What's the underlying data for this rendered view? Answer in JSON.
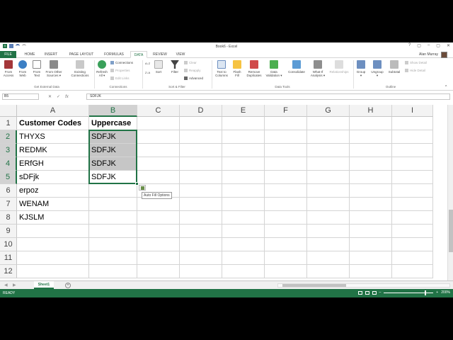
{
  "window": {
    "title": "Book6 - Excel"
  },
  "window_controls": [
    "?",
    "▢",
    "–",
    "▢",
    "✕"
  ],
  "tabs": [
    "FILE",
    "HOME",
    "INSERT",
    "PAGE LAYOUT",
    "FORMULAS",
    "DATA",
    "REVIEW",
    "VIEW"
  ],
  "user": {
    "name": "Alan Murray"
  },
  "ribbon": {
    "get_external": {
      "buttons": [
        {
          "label": "From\nAccess",
          "icon": "access-icon"
        },
        {
          "label": "From\nWeb",
          "icon": "web-icon"
        },
        {
          "label": "From\nText",
          "icon": "text-file-icon"
        },
        {
          "label": "From Other\nSources ▾",
          "icon": "other-sources-icon"
        },
        {
          "label": "Existing\nConnections",
          "icon": "existing-connections-icon"
        }
      ],
      "group_label": "Get External Data"
    },
    "connections": {
      "refresh_label": "Refresh\nAll ▾",
      "items": [
        "Connections",
        "Properties",
        "Edit Links"
      ],
      "group_label": "Connections"
    },
    "sort_filter": {
      "sort_label": "Sort",
      "filter_label": "Filter",
      "items": [
        "Clear",
        "Reapply",
        "Advanced"
      ],
      "group_label": "Sort & Filter"
    },
    "data_tools": {
      "buttons": [
        "Text to\nColumns",
        "Flash\nFill",
        "Remove\nDuplicates",
        "Data\nValidation ▾",
        "Consolidate",
        "What-If\nAnalysis ▾",
        "Relationships"
      ],
      "group_label": "Data Tools"
    },
    "outline": {
      "buttons": [
        "Group\n▾",
        "Ungroup\n▾",
        "Subtotal"
      ],
      "items": [
        "Show Detail",
        "Hide Detail"
      ],
      "group_label": "Outline"
    }
  },
  "formula_bar": {
    "name_box": "B5",
    "content": "SDFJK",
    "icons": [
      "✕",
      "✓",
      "fx"
    ]
  },
  "columns": [
    "A",
    "B",
    "C",
    "D",
    "E",
    "F",
    "G",
    "H",
    "I"
  ],
  "rows": [
    "1",
    "2",
    "3",
    "4",
    "5",
    "6",
    "7",
    "8",
    "9",
    "10",
    "11",
    "12"
  ],
  "cells": {
    "A1": "Customer Codes",
    "B1": "Uppercase",
    "A2": "THYXS",
    "B2": "SDFJK",
    "A3": "REDMK",
    "B3": "SDFJK",
    "A4": "ERfGH",
    "B4": "SDFJK",
    "A5": "sDFjk",
    "B5": "SDFJK",
    "A6": "erpoz",
    "A7": "WENAM",
    "A8": "KJSLM"
  },
  "autofill_tooltip": "Auto Fill Options",
  "sheets": [
    "Sheet1"
  ],
  "status": {
    "ready": "READY",
    "zoom": "200%"
  },
  "colors": {
    "accent": "#217346",
    "selection_fill": "#c6c6c6"
  }
}
